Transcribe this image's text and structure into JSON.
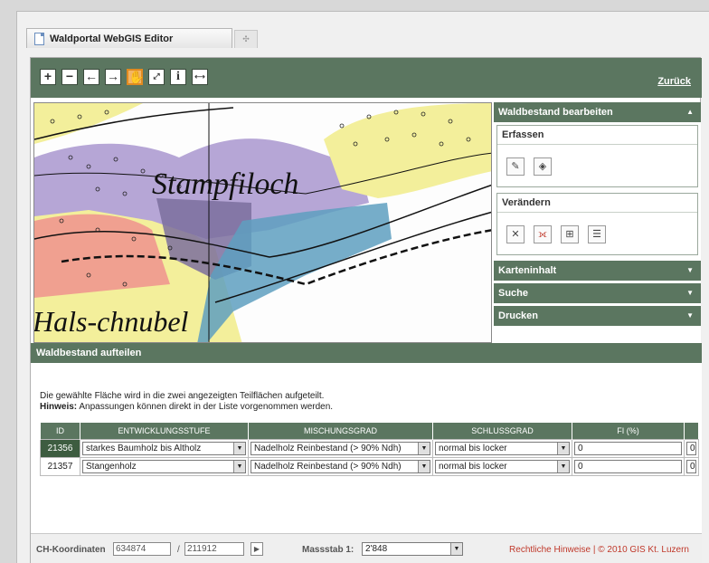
{
  "browser": {
    "tab_title": "Waldportal WebGIS Editor"
  },
  "toolbar": {
    "tools": [
      "zoom-in",
      "zoom-out",
      "back",
      "forward",
      "pan",
      "full-extent",
      "info",
      "measure"
    ],
    "active_tool": "pan",
    "back_link": "Zurück"
  },
  "map": {
    "labels": [
      "Stampfiloch",
      "Hals-chnubel"
    ]
  },
  "sidebar": {
    "edit_panel_title": "Waldbestand bearbeiten",
    "erfassen_title": "Erfassen",
    "veraendern_title": "Verändern",
    "sections": [
      "Karteninhalt",
      "Suche",
      "Drucken"
    ]
  },
  "dialog": {
    "title": "Waldbestand aufteilen",
    "text": "Die gewählte Fläche wird in die zwei angezeigten Teilflächen aufgeteilt.",
    "hint_label": "Hinweis:",
    "hint_text": " Anpassungen können direkt in der Liste vorgenommen werden.",
    "columns": [
      "ID",
      "ENTWICKLUNGSSTUFE",
      "MISCHUNGSGRAD",
      "SCHLUSSGRAD",
      "FI (%)"
    ],
    "rows": [
      {
        "id": "21356",
        "stufe": "starkes Baumholz bis Altholz",
        "misch": "Nadelholz Reinbestand (> 90% Ndh)",
        "schluss": "normal bis locker",
        "fi": "0",
        "extra": "0"
      },
      {
        "id": "21357",
        "stufe": "Stangenholz",
        "misch": "Nadelholz Reinbestand (> 90% Ndh)",
        "schluss": "normal bis locker",
        "fi": "0",
        "extra": "0"
      }
    ]
  },
  "statusbar": {
    "coord_label": "CH-Koordinaten",
    "x": "634874",
    "sep": "/",
    "y": "211912",
    "scale_label": "Massstab 1:",
    "scale_value": "2'848",
    "legal": "Rechtliche Hinweise | © 2010 GIS Kt. Luzern"
  }
}
